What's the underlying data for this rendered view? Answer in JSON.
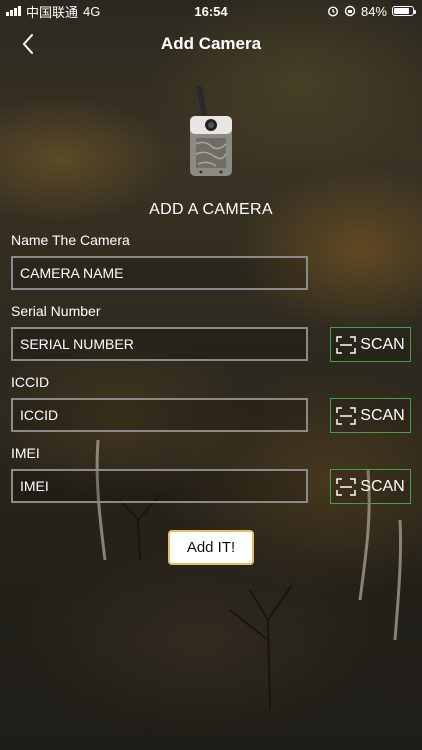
{
  "status_bar": {
    "carrier": "中国联通",
    "network": "4G",
    "time": "16:54",
    "battery": "84%",
    "battery_level": 0.84
  },
  "nav": {
    "title": "Add Camera"
  },
  "heading": "ADD A CAMERA",
  "form": {
    "name": {
      "label": "Name The Camera",
      "placeholder": "CAMERA NAME"
    },
    "serial": {
      "label": "Serial Number",
      "placeholder": "SERIAL NUMBER",
      "scan_label": "SCAN"
    },
    "iccid": {
      "label": "ICCID",
      "placeholder": "ICCID",
      "scan_label": "SCAN"
    },
    "imei": {
      "label": "IMEI",
      "placeholder": "IMEI",
      "scan_label": "SCAN"
    }
  },
  "submit_label": "Add IT!",
  "colors": {
    "scan_border": "#45a049",
    "submit_border": "#e6c060"
  }
}
